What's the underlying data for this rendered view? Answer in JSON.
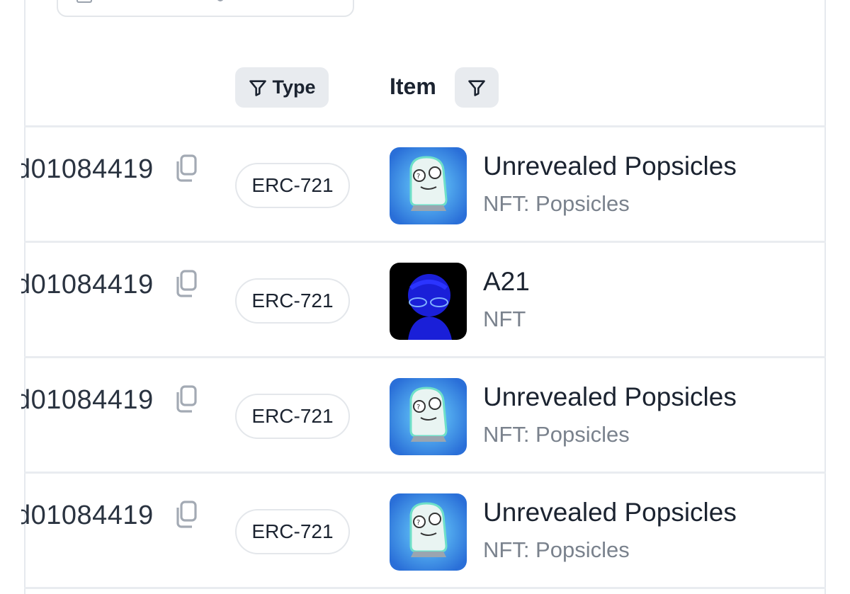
{
  "header": {
    "type_filter_label": "Type",
    "item_column_label": "Item"
  },
  "rows": [
    {
      "hash_fragment": "d01084419",
      "type": "ERC-721",
      "item_name": "Unrevealed Popsicles",
      "item_subtitle": "NFT: Popsicles",
      "thumbnail": "popsicle-ghost"
    },
    {
      "hash_fragment": "d01084419",
      "type": "ERC-721",
      "item_name": "A21",
      "item_subtitle": "NFT",
      "thumbnail": "blue-portrait"
    },
    {
      "hash_fragment": "d01084419",
      "type": "ERC-721",
      "item_name": "Unrevealed Popsicles",
      "item_subtitle": "NFT: Popsicles",
      "thumbnail": "popsicle-ghost"
    },
    {
      "hash_fragment": "d01084419",
      "type": "ERC-721",
      "item_name": "Unrevealed Popsicles",
      "item_subtitle": "NFT: Popsicles",
      "thumbnail": "popsicle-ghost"
    }
  ],
  "icons": {
    "filter": "funnel-icon",
    "copy": "copy-icon"
  },
  "colors": {
    "text_primary": "#1b2330",
    "text_secondary": "#7a828d",
    "filter_bg": "#e8ebef",
    "border": "#e4e7eb",
    "popsicle_bg": "#3b8ee8",
    "portrait_bg": "#000000"
  }
}
